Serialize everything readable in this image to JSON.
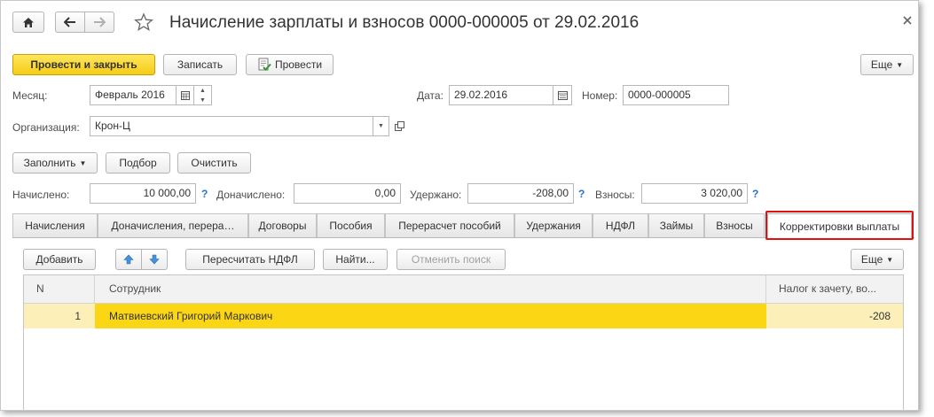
{
  "title": "Начисление зарплаты и взносов 0000-000005 от 29.02.2016",
  "toolbar": {
    "post_close": "Провести и закрыть",
    "save": "Записать",
    "post": "Провести",
    "more": "Еще"
  },
  "form": {
    "month_label": "Месяц:",
    "month_value": "Февраль 2016",
    "date_label": "Дата:",
    "date_value": "29.02.2016",
    "number_label": "Номер:",
    "number_value": "0000-000005",
    "org_label": "Организация:",
    "org_value": "Крон-Ц"
  },
  "actions": {
    "fill": "Заполнить",
    "pick": "Подбор",
    "clear": "Очистить"
  },
  "totals": {
    "accrued_label": "Начислено:",
    "accrued_value": "10 000,00",
    "extra_label": "Доначислено:",
    "extra_value": "0,00",
    "withheld_label": "Удержано:",
    "withheld_value": "-208,00",
    "contrib_label": "Взносы:",
    "contrib_value": "3 020,00",
    "help": "?"
  },
  "tabs": [
    {
      "label": "Начисления"
    },
    {
      "label": "Доначисления, перера…"
    },
    {
      "label": "Договоры"
    },
    {
      "label": "Пособия"
    },
    {
      "label": "Перерасчет пособий"
    },
    {
      "label": "Удержания"
    },
    {
      "label": "НДФЛ"
    },
    {
      "label": "Займы"
    },
    {
      "label": "Взносы"
    },
    {
      "label": "Корректировки выплаты"
    }
  ],
  "tab_toolbar": {
    "add": "Добавить",
    "recalc": "Пересчитать НДФЛ",
    "find": "Найти...",
    "cancel_search": "Отменить поиск",
    "more": "Еще"
  },
  "table": {
    "columns": [
      "N",
      "Сотрудник",
      "Налог к зачету, во..."
    ],
    "rows": [
      {
        "n": "1",
        "employee": "Матвиевский Григорий Маркович",
        "tax": "-208"
      }
    ]
  },
  "colors": {
    "accent_yellow": "#f6cc16",
    "selection_yellow": "#fbd615",
    "row_highlight": "#fcefb8",
    "tab_highlight_border": "#e01010",
    "help_blue": "#2a6fc9"
  }
}
